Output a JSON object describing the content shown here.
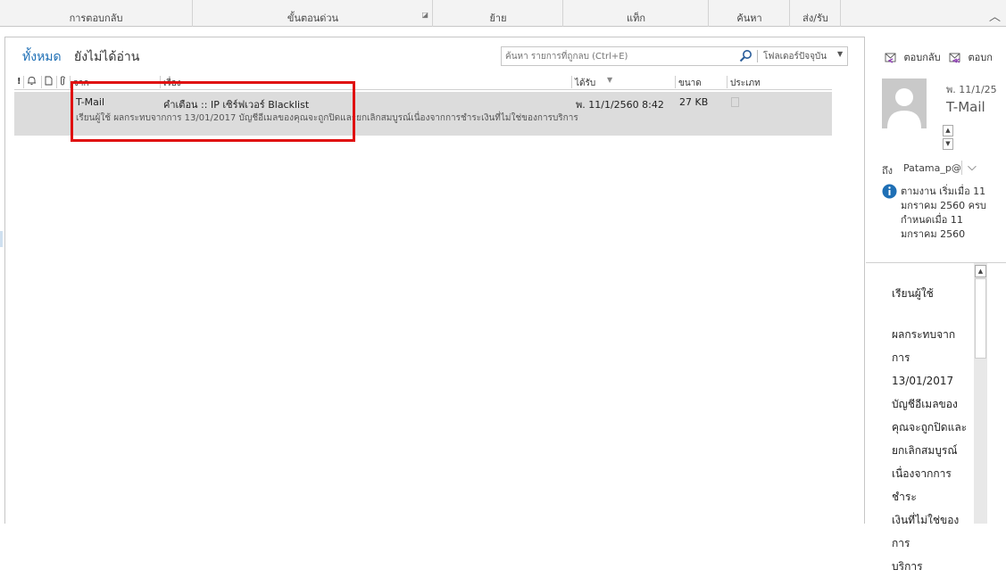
{
  "ribbon": {
    "groups": [
      "การตอบกลับ",
      "ขั้นตอนด่วน",
      "ย้าย",
      "แท็ก",
      "ค้นหา",
      "ส่ง/รับ"
    ]
  },
  "filters": {
    "all": "ทั้งหมด",
    "unread": "ยังไม่ได้อ่าน"
  },
  "search": {
    "placeholder": "ค้นหา รายการที่ถูกลบ (Ctrl+E)",
    "scope": "โฟลเดอร์ปัจจุบัน"
  },
  "columns": {
    "importance": "!",
    "reminder": "",
    "icon": "",
    "attachment": "",
    "from": "จาก",
    "subject": "เรื่อง",
    "received": "ได้รับ",
    "size": "ขนาด",
    "category": "ประเภท"
  },
  "messages": [
    {
      "from": "T-Mail",
      "subject": "คำเตือน :: IP เซิร์ฟเวอร์ Blacklist",
      "preview": "เรียนผู้ใช้  ผลกระทบจากการ 13/01/2017  บัญชีอีเมลของคุณจะถูกปิดและยกเลิกสมบูรณ์เนื่องจากการชำระเงินที่ไม่ใช่ของการบริการ",
      "received": "พ. 11/1/2560 8:42",
      "size": "27 KB"
    }
  ],
  "reading_pane": {
    "reply_label": "ตอบกลับ",
    "reply_all_label": "ตอบก",
    "date": "พ. 11/1/25",
    "sender": "T-Mail",
    "to_label": "ถึง",
    "to": "Patama_p@",
    "followup": "ตามงาน เริ่มเมื่อ 11 มกราคม 2560 ครบกำหนดเมื่อ 11 มกราคม 2560",
    "body": [
      "เรียนผู้ใช้",
      "ผลกระทบจาก",
      "การ",
      "13/01/2017",
      "บัญชีอีเมลของ",
      "คุณจะถูกปิดและ",
      "ยกเลิกสมบูรณ์",
      "เนื่องจากการชำระ",
      "เงินที่ไม่ใช่ของการ",
      "บริการ"
    ]
  },
  "colors": {
    "accent": "#1e6fb5",
    "highlight_box": "#e01010",
    "selected_row": "#dcdcdc"
  },
  "icons": [
    "dialog-launcher-icon",
    "search-icon",
    "dropdown-arrow-icon",
    "sort-desc-icon",
    "reply-icon",
    "reply-all-icon",
    "person-avatar-icon",
    "info-icon",
    "chevron-down-icon",
    "scroll-up-icon",
    "scroll-down-icon",
    "collapse-ribbon-icon",
    "bell-icon",
    "document-icon",
    "paperclip-icon"
  ]
}
